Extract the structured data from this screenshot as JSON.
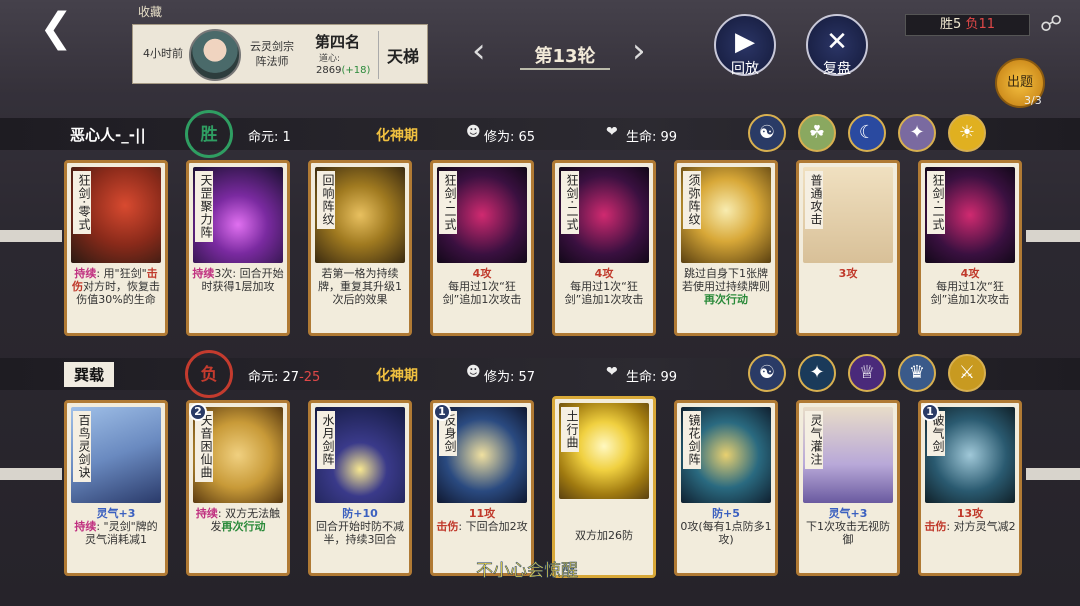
{
  "header": {
    "back_icon": "back-arrow-icon",
    "favorite_label": "收藏",
    "profile": {
      "time_ago": "4小时前",
      "sect": "云灵剑宗",
      "class": "阵法师",
      "rank": "第四名",
      "dao_label": "道心:",
      "dao_value": "2869",
      "dao_delta": "(+18)",
      "mode": "天梯"
    },
    "round": "第13轮",
    "replay": "回放",
    "review": "复盘",
    "wins": "胜5",
    "losses": "负11",
    "quest": "出题",
    "quest_count": "3/3"
  },
  "top_player": {
    "name": "恶心人-_-||",
    "result": "胜",
    "life_label": "命元:",
    "life_value": "1",
    "realm": "化神期",
    "cultivation_label": "修为:",
    "cultivation_value": "65",
    "hp_label": "生命:",
    "hp_value": "99",
    "cards": [
      {
        "title": "狂剑·零式",
        "desc": [
          "持续: 用“狂剑”击伤对方时，恢复击伤值30%的生命"
        ]
      },
      {
        "title": "天罡聚力阵",
        "desc": [
          "持续3次: 回合开始时获得1层加攻"
        ]
      },
      {
        "title": "回响阵纹",
        "desc": [
          "若第一格为持续牌，重复其升级1次后的效果"
        ]
      },
      {
        "title": "狂剑·二式",
        "desc": [
          "4攻",
          "每用过1次“狂剑”追加1次攻击"
        ]
      },
      {
        "title": "狂剑·二式",
        "desc": [
          "4攻",
          "每用过1次“狂剑”追加1次攻击"
        ]
      },
      {
        "title": "须弥阵纹",
        "desc": [
          "跳过自身下1张牌",
          "若使用过持续牌则再次行动"
        ]
      },
      {
        "title": "普通攻击",
        "desc": [
          "3攻"
        ]
      },
      {
        "title": "狂剑·二式",
        "desc": [
          "4攻",
          "每用过1次“狂剑”追加1次攻击"
        ]
      }
    ]
  },
  "bottom_player": {
    "name": "巽载",
    "result": "负",
    "life_label": "命元:",
    "life_value": "27",
    "life_delta": "-25",
    "realm": "化神期",
    "cultivation_label": "修为:",
    "cultivation_value": "57",
    "hp_label": "生命:",
    "hp_value": "99",
    "cards": [
      {
        "title": "百鸟灵剑诀",
        "badge": "",
        "desc": [
          "灵气+3",
          "持续: “灵剑”牌的灵气消耗减1"
        ]
      },
      {
        "title": "天音困仙曲",
        "badge": "2",
        "desc": [
          "持续: 双方无法触发再次行动"
        ]
      },
      {
        "title": "水月剑阵",
        "badge": "",
        "desc": [
          "防+10",
          "回合开始时防不减半，持续3回合"
        ]
      },
      {
        "title": "反身剑",
        "badge": "1",
        "desc": [
          "11攻",
          "击伤: 下回合加2攻"
        ]
      },
      {
        "title": "土行曲",
        "badge": "",
        "desc": [
          "双方加26防"
        ]
      },
      {
        "title": "镜花剑阵",
        "badge": "",
        "desc": [
          "防+5",
          "0攻(每有1点防多1攻)"
        ]
      },
      {
        "title": "灵气灌注",
        "badge": "",
        "desc": [
          "灵气+3",
          "下1次攻击无视防御"
        ]
      },
      {
        "title": "破气剑",
        "badge": "1",
        "desc": [
          "13攻",
          "击伤: 对方灵气减2"
        ]
      }
    ]
  },
  "watermark": "不小心会惊醒",
  "colors": {
    "win": "#2f9e62",
    "loss": "#c43b2e",
    "realm": "#f0c040",
    "card_border": "#b07a34"
  }
}
